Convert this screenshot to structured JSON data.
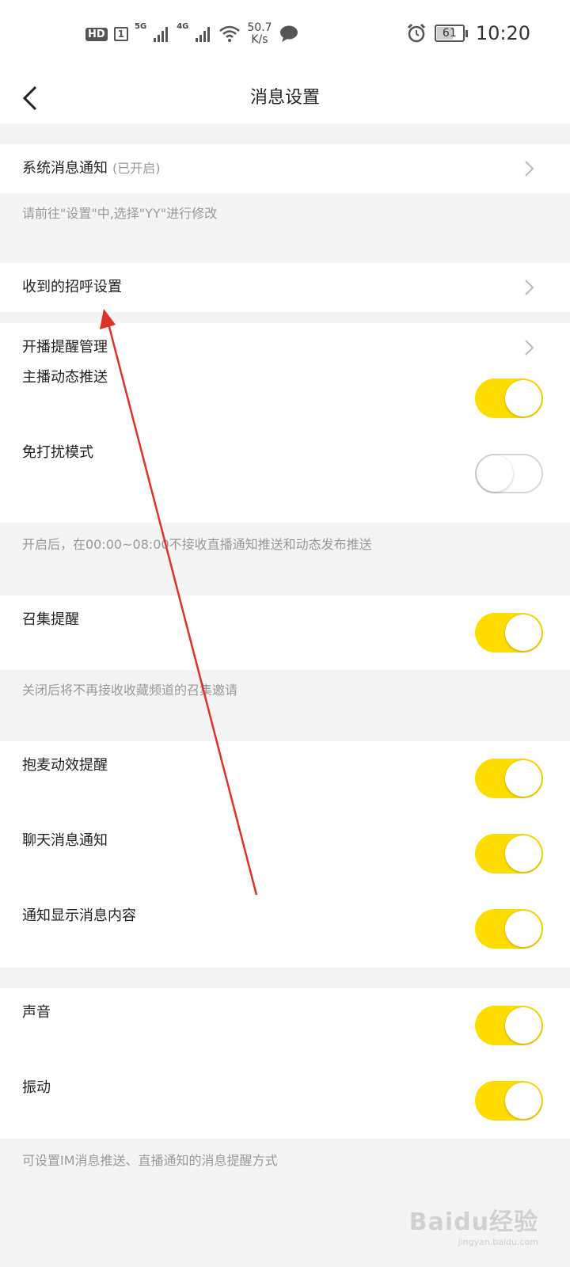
{
  "status_bar": {
    "hd": "HD",
    "sim": "1",
    "net1": "5G",
    "net2": "4G",
    "speed_value": "50.7",
    "speed_unit": "K/s",
    "battery": "61",
    "time": "10:20"
  },
  "header": {
    "title": "消息设置"
  },
  "settings": {
    "system_notify": {
      "label": "系统消息通知",
      "status": "(已开启)"
    },
    "system_hint": "请前往\"设置\"中,选择\"YY\"进行修改",
    "greeting": {
      "label": "收到的招呼设置"
    },
    "live_remind": {
      "label": "开播提醒管理"
    },
    "anchor_push": {
      "label": "主播动态推送",
      "enabled": true
    },
    "dnd_mode": {
      "label": "免打扰模式",
      "enabled": false
    },
    "dnd_hint": "开启后，在00:00~08:00不接收直播通知推送和动态发布推送",
    "gather_remind": {
      "label": "召集提醒",
      "enabled": true
    },
    "gather_hint": "关闭后将不再接收收藏频道的召集邀请",
    "mic_effect": {
      "label": "抱麦动效提醒",
      "enabled": true
    },
    "chat_notify": {
      "label": "聊天消息通知",
      "enabled": true
    },
    "show_content": {
      "label": "通知显示消息内容",
      "enabled": true
    },
    "sound": {
      "label": "声音",
      "enabled": true
    },
    "vibrate": {
      "label": "振动",
      "enabled": true
    },
    "remind_hint": "可设置IM消息推送、直播通知的消息提醒方式"
  },
  "watermark": {
    "main": "Baidu经验",
    "sub": "jingyan.baidu.com"
  },
  "colors": {
    "accent": "#ffdc00",
    "annotation": "#e0302a"
  }
}
